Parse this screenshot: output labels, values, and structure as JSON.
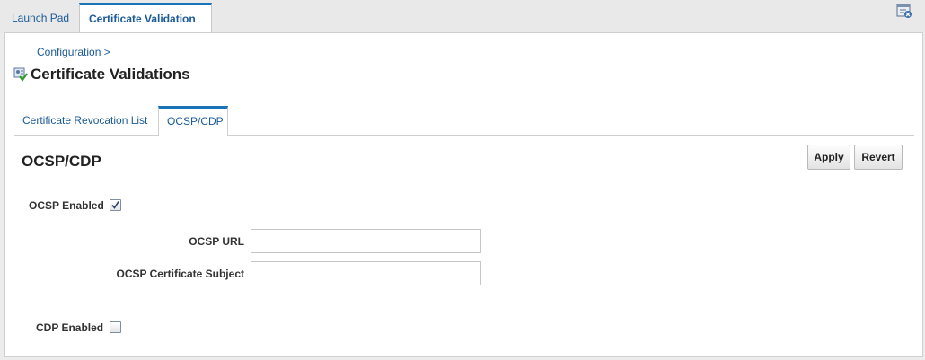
{
  "top_tabs": {
    "launch_pad": "Launch Pad",
    "active": "Certificate Validation",
    "close_glyph": "×"
  },
  "breadcrumb": "Configuration >",
  "page_title": "Certificate Validations",
  "sub_tabs": {
    "crl": "Certificate Revocation List",
    "ocsp": "OCSP/CDP"
  },
  "section": {
    "title": "OCSP/CDP",
    "apply_label": "Apply",
    "revert_label": "Revert"
  },
  "form": {
    "ocsp_enabled_label": "OCSP Enabled",
    "ocsp_enabled_checked": true,
    "ocsp_url_label": "OCSP URL",
    "ocsp_url_value": "",
    "ocsp_subject_label": "OCSP Certificate Subject",
    "ocsp_subject_value": "",
    "cdp_enabled_label": "CDP Enabled",
    "cdp_enabled_checked": false
  },
  "icons": {
    "corner": "close-window-icon",
    "title": "certificate-check-icon"
  },
  "colors": {
    "accent": "#1c74b8",
    "link": "#1a5a96"
  }
}
